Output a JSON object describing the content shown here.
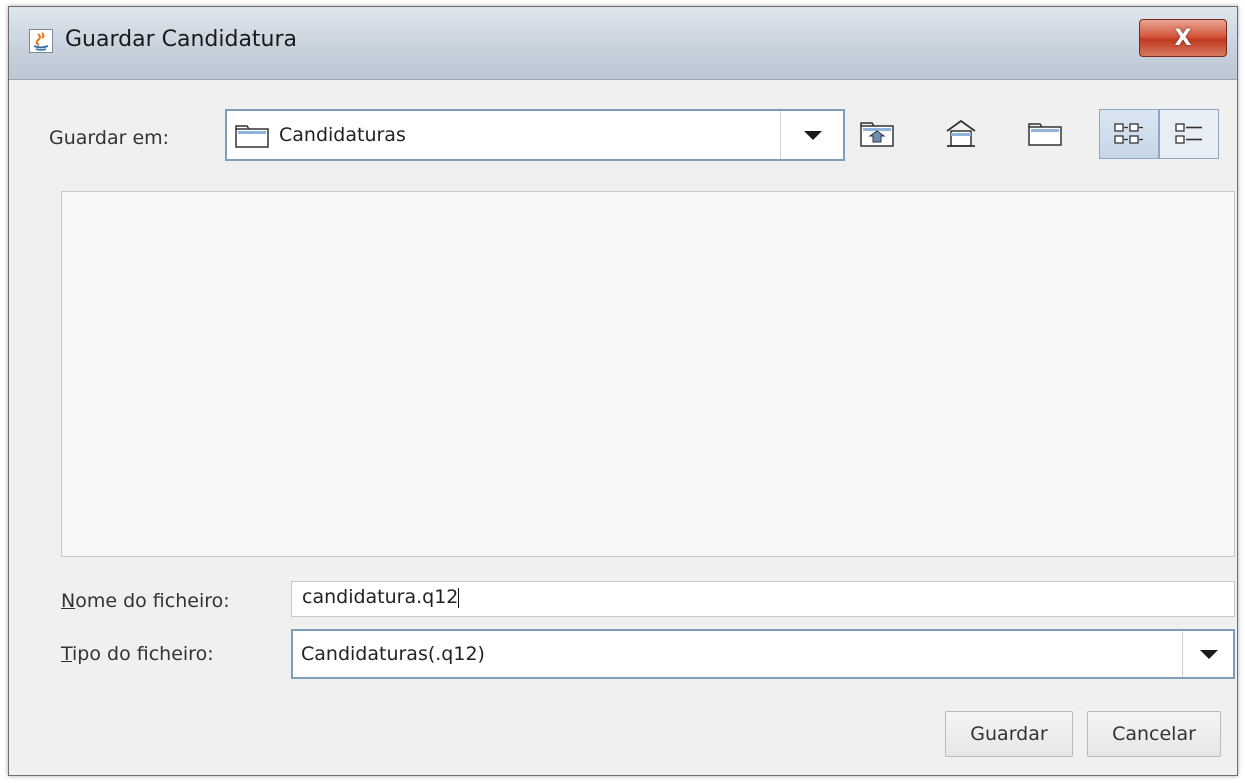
{
  "window": {
    "title": "Guardar Candidatura",
    "close_label": "X"
  },
  "save_in": {
    "label": "Guardar em:",
    "value": "Candidaturas"
  },
  "toolbar": {
    "icons": [
      "up-folder-icon",
      "home-icon",
      "new-folder-icon",
      "list-view-icon",
      "details-view-icon"
    ],
    "selected_view": "list-view-icon"
  },
  "filename": {
    "label_first": "N",
    "label_rest": "ome do ficheiro:",
    "value": "candidatura.q12"
  },
  "filetype": {
    "label_first": "T",
    "label_rest": "ipo do ficheiro:",
    "value": "Candidaturas(.q12)"
  },
  "buttons": {
    "save": "Guardar",
    "cancel": "Cancelar"
  },
  "colors": {
    "combo_border": "#7f9db9",
    "close_button": "#c03a21"
  }
}
